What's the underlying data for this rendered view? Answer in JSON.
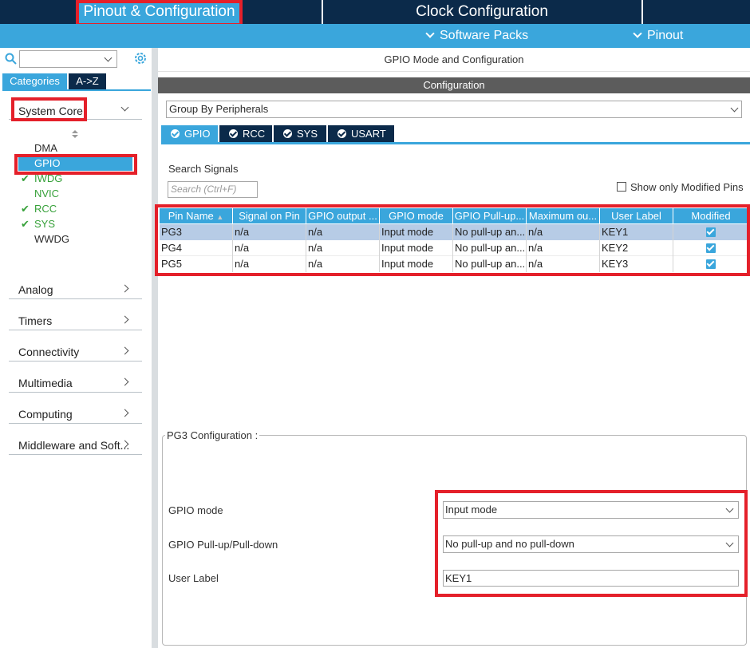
{
  "top_tabs": {
    "pinout": "Pinout & Configuration",
    "clock": "Clock Configuration"
  },
  "sub_bar": {
    "software_packs": "Software Packs",
    "pinout": "Pinout"
  },
  "left": {
    "category_tabs": [
      "Categories",
      "A->Z"
    ],
    "system_core": {
      "label": "System Core",
      "items": [
        {
          "label": "DMA",
          "checked": false
        },
        {
          "label": "GPIO",
          "checked": false
        },
        {
          "label": "IWDG",
          "checked": true
        },
        {
          "label": "NVIC",
          "checked": false
        },
        {
          "label": "RCC",
          "checked": true
        },
        {
          "label": "SYS",
          "checked": true
        },
        {
          "label": "WWDG",
          "checked": false
        }
      ]
    },
    "sections": [
      "Analog",
      "Timers",
      "Connectivity",
      "Multimedia",
      "Computing",
      "Middleware and Soft..."
    ]
  },
  "main": {
    "header": "GPIO Mode and Configuration",
    "config_header": "Configuration",
    "group_by": "Group By Peripherals",
    "peripheral_tabs": [
      "GPIO",
      "RCC",
      "SYS",
      "USART"
    ],
    "search_label": "Search Signals",
    "search_placeholder": "Search (Ctrl+F)",
    "show_modified": "Show only Modified Pins",
    "table": {
      "columns": [
        "Pin Name",
        "Signal on Pin",
        "GPIO output ...",
        "GPIO mode",
        "GPIO Pull-up...",
        "Maximum ou...",
        "User Label",
        "Modified"
      ],
      "rows": [
        [
          "PG3",
          "n/a",
          "n/a",
          "Input mode",
          "No pull-up an...",
          "n/a",
          "KEY1"
        ],
        [
          "PG4",
          "n/a",
          "n/a",
          "Input mode",
          "No pull-up an...",
          "n/a",
          "KEY2"
        ],
        [
          "PG5",
          "n/a",
          "n/a",
          "Input mode",
          "No pull-up an...",
          "n/a",
          "KEY3"
        ]
      ]
    },
    "pin_config": {
      "title": "PG3 Configuration :",
      "gpio_mode_label": "GPIO mode",
      "gpio_mode_value": "Input mode",
      "pull_label": "GPIO Pull-up/Pull-down",
      "pull_value": "No pull-up and no pull-down",
      "user_label_label": "User Label",
      "user_label_value": "KEY1"
    }
  },
  "colors": {
    "accent": "#3aa6dc",
    "navy": "#0b2a4a",
    "highlight": "#e4202a",
    "check_green": "#37a13a"
  }
}
